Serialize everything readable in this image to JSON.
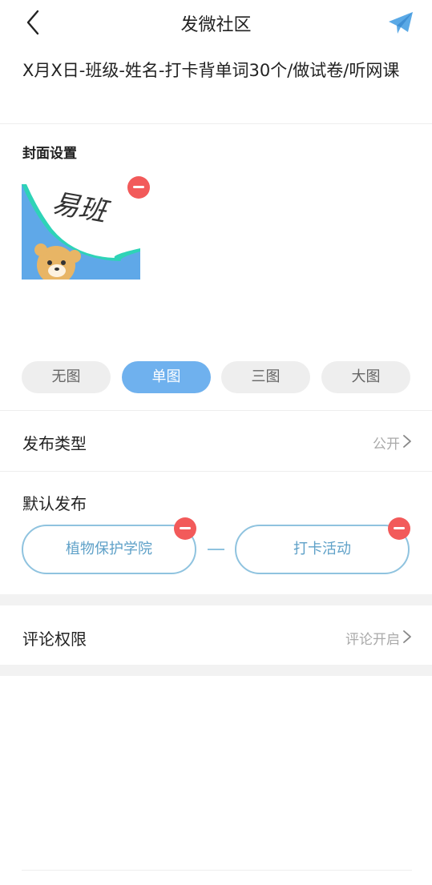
{
  "nav": {
    "title": "发微社区",
    "back_icon": "chevron-left-icon",
    "send_icon": "paper-plane-icon",
    "accent_color": "#5aa9e6"
  },
  "post": {
    "title_placeholder": "X月X日-班级-姓名-打卡背单词30个/做试卷/听网课"
  },
  "cover": {
    "label": "封面设置",
    "image_text": "易班",
    "remove_icon": "minus-circle-icon",
    "modes": [
      "无图",
      "单图",
      "三图",
      "大图"
    ],
    "selected_mode": "单图"
  },
  "publish_type": {
    "label": "发布类型",
    "value": "公开"
  },
  "default_publish": {
    "label": "默认发布",
    "tags": [
      "植物保护学院",
      "打卡活动"
    ],
    "separator": "—"
  },
  "comment_permission": {
    "label": "评论权限",
    "value": "评论开启"
  },
  "colors": {
    "active_mode": "#6fb1ee",
    "remove_badge": "#f25a5a",
    "tag_border": "#8fc3df"
  }
}
